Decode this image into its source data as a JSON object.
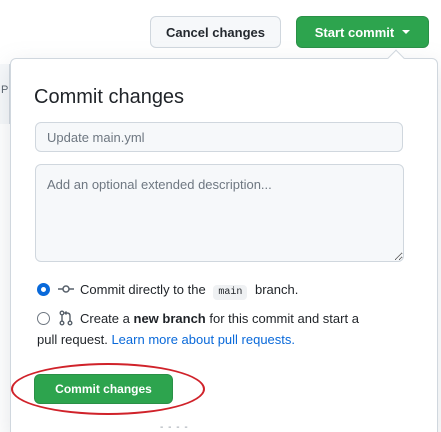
{
  "background": {
    "edge_letter": "P"
  },
  "header": {
    "cancel_label": "Cancel changes",
    "start_commit_label": "Start commit"
  },
  "dialog": {
    "title": "Commit changes",
    "summary_placeholder": "Update main.yml",
    "description_placeholder": "Add an optional extended description...",
    "option_direct": {
      "prefix": "Commit directly to the",
      "branch": "main",
      "suffix": "branch.",
      "selected": true
    },
    "option_new_branch": {
      "prefix": "Create a",
      "bold": "new branch",
      "middle": "for this commit and start a",
      "line2": "pull request.",
      "link": "Learn more about pull requests.",
      "selected": false
    },
    "commit_label": "Commit changes"
  },
  "colors": {
    "primary_green": "#2da44e",
    "link_blue": "#0969da",
    "highlight_red": "#d0222a"
  },
  "icons": {
    "commit": "git-commit-icon",
    "pull_request": "git-pull-request-icon",
    "caret": "caret-down-icon"
  }
}
